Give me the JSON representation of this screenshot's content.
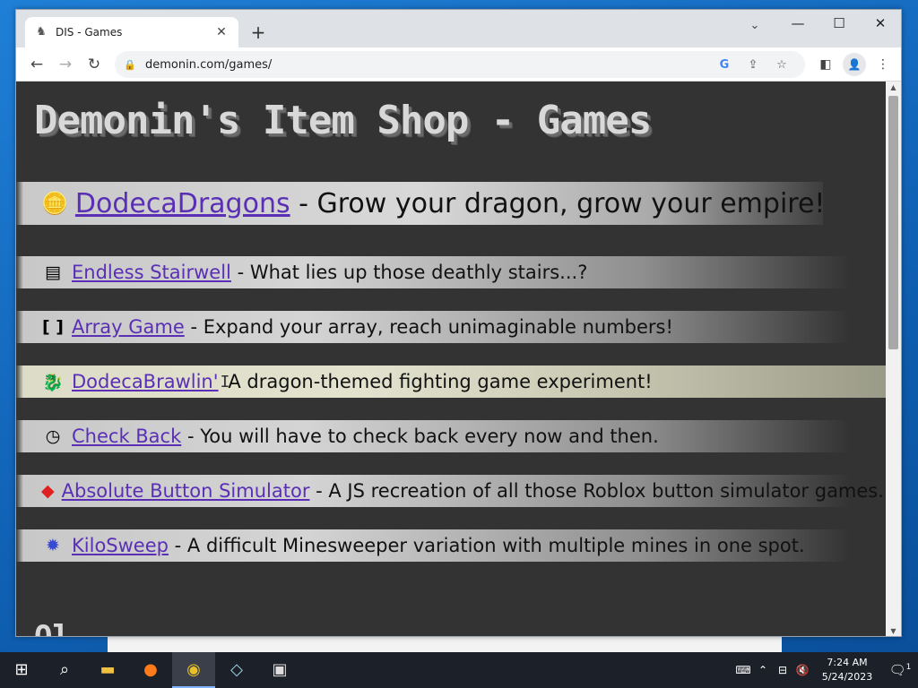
{
  "browser": {
    "tab_title": "DIS - Games",
    "tab_favicon": "dragon-favicon",
    "url": "demonin.com/games/"
  },
  "page": {
    "title": "Demonin's Item Shop - Games",
    "featured": {
      "name": "DodecaDragons",
      "description": "- Grow your dragon, grow your empire!",
      "icon": "coins-icon"
    },
    "games": [
      {
        "name": "Endless Stairwell",
        "description": "- What lies up those deathly stairs...?",
        "icon": "stairs-icon"
      },
      {
        "name": "Array Game",
        "description": "- Expand your array, reach unimaginable numbers!",
        "icon": "brackets-icon"
      },
      {
        "name": "DodecaBrawlin'",
        "description": "A dragon-themed fighting game experiment!",
        "icon": "dragon-icon"
      },
      {
        "name": "Check Back",
        "description": "- You will have to check back every now and then.",
        "icon": "clock-icon"
      },
      {
        "name": "Absolute Button Simulator",
        "description": "- A JS recreation of all those Roblox button simulator games.",
        "icon": "roblox-icon"
      },
      {
        "name": "KiloSweep",
        "description": "- A difficult Minesweeper variation with multiple mines in one spot.",
        "icon": "mine-icon"
      }
    ],
    "next_heading_partial": "Ol..."
  },
  "taskbar": {
    "time": "7:24 AM",
    "date": "5/24/2023",
    "notification_count": "1"
  },
  "colors": {
    "page_bg": "#333333",
    "link": "#5a2fb5",
    "title": "#d8d8d8"
  }
}
